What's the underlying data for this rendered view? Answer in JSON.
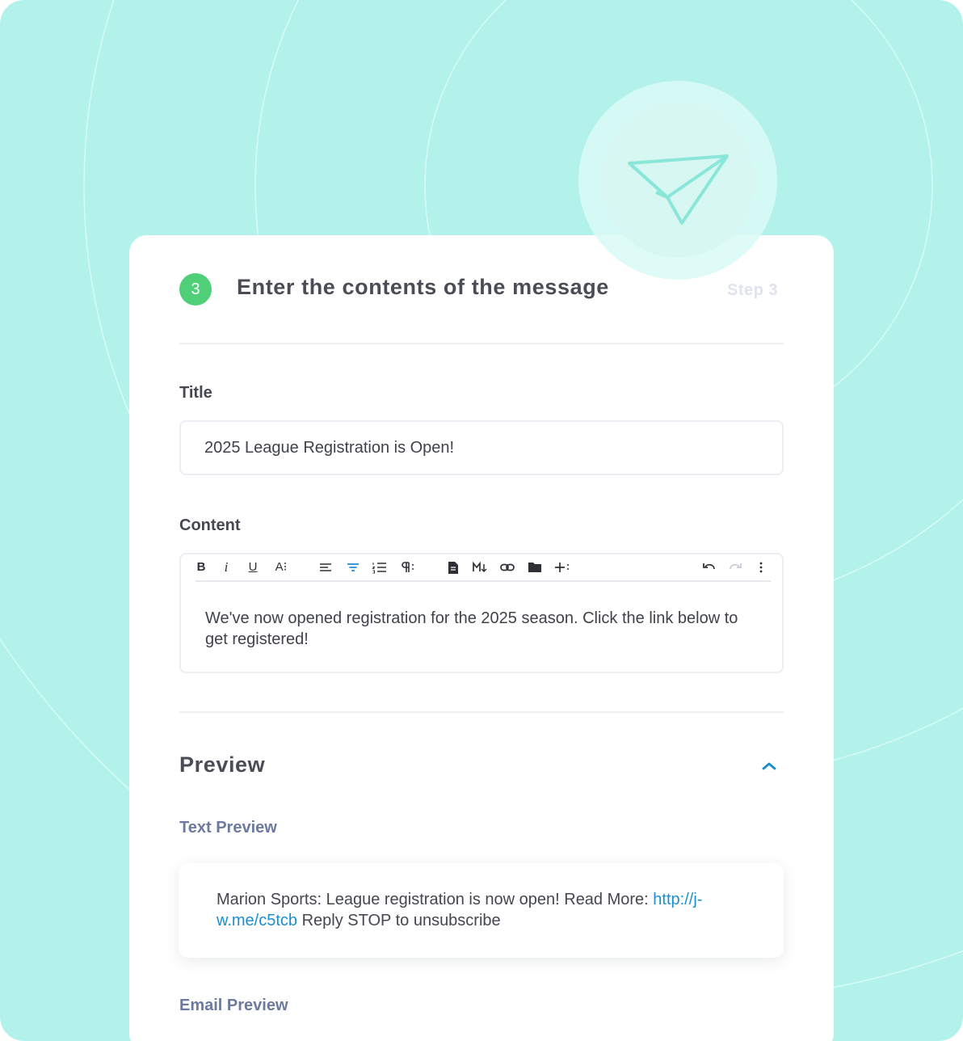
{
  "step": {
    "number": "3",
    "title": "Enter the contents of the message",
    "label": "Step 3"
  },
  "title_field": {
    "label": "Title",
    "value": "2025 League Registration is Open!"
  },
  "content_field": {
    "label": "Content",
    "text": "We've now opened registration for the 2025 season. Click the link below to get registered!",
    "toolbar": {
      "bold": "B",
      "italic": "i",
      "underline": "U",
      "font_size": "A⁝"
    }
  },
  "preview": {
    "title": "Preview",
    "text_preview_label": "Text Preview",
    "text_before": "Marion Sports: League registration is now open! Read More: ",
    "link": "http://j-w.me/c5tcb",
    "text_after": " Reply STOP to unsubscribe",
    "email_preview_label": "Email Preview"
  },
  "icons": {
    "badge": "paper-plane-icon",
    "collapse": "chevron-up-icon"
  },
  "colors": {
    "background": "#b2f2ea",
    "step_badge": "#4ecf78",
    "accent": "#1a8fd0",
    "sub_label": "#6c7aa0"
  }
}
